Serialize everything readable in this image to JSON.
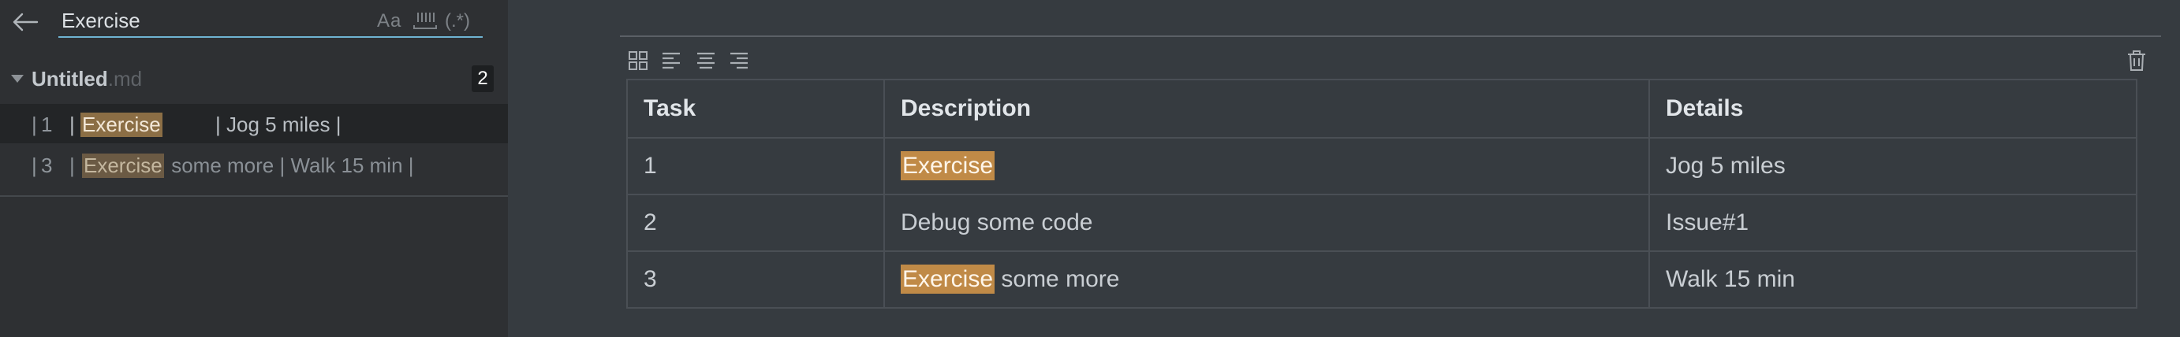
{
  "search": {
    "query": "Exercise",
    "opt_case": "Aa",
    "opt_regex": "(.*)"
  },
  "results": {
    "file_name": "Untitled",
    "file_ext": ".md",
    "match_count": "2",
    "items": [
      {
        "line": "1",
        "pre": "| ",
        "match": "Exercise",
        "post": "         | Jog 5 miles |"
      },
      {
        "line": "3",
        "pre": "| ",
        "match": "Exercise",
        "post": " some more | Walk 15 min |"
      }
    ]
  },
  "table": {
    "headers": [
      "Task",
      "Description",
      "Details"
    ],
    "rows": [
      {
        "task": "1",
        "desc_match": "Exercise",
        "desc_rest": "",
        "details": "Jog 5 miles"
      },
      {
        "task": "2",
        "desc_text": "Debug some code",
        "details": "Issue#1"
      },
      {
        "task": "3",
        "desc_match": "Exercise",
        "desc_rest": " some more",
        "details": "Walk 15 min"
      }
    ]
  },
  "colors": {
    "sidebar_bg": "#2e3033",
    "editor_bg": "#363b40",
    "accent": "#6fb3d2",
    "highlight": "#c08a47"
  },
  "icons": {
    "back": "arrow-left-icon",
    "word": "whole-word-icon",
    "grid": "table-grid-icon",
    "align_left": "align-left-icon",
    "align_center": "align-center-icon",
    "align_right": "align-right-icon",
    "delete": "trash-icon"
  }
}
